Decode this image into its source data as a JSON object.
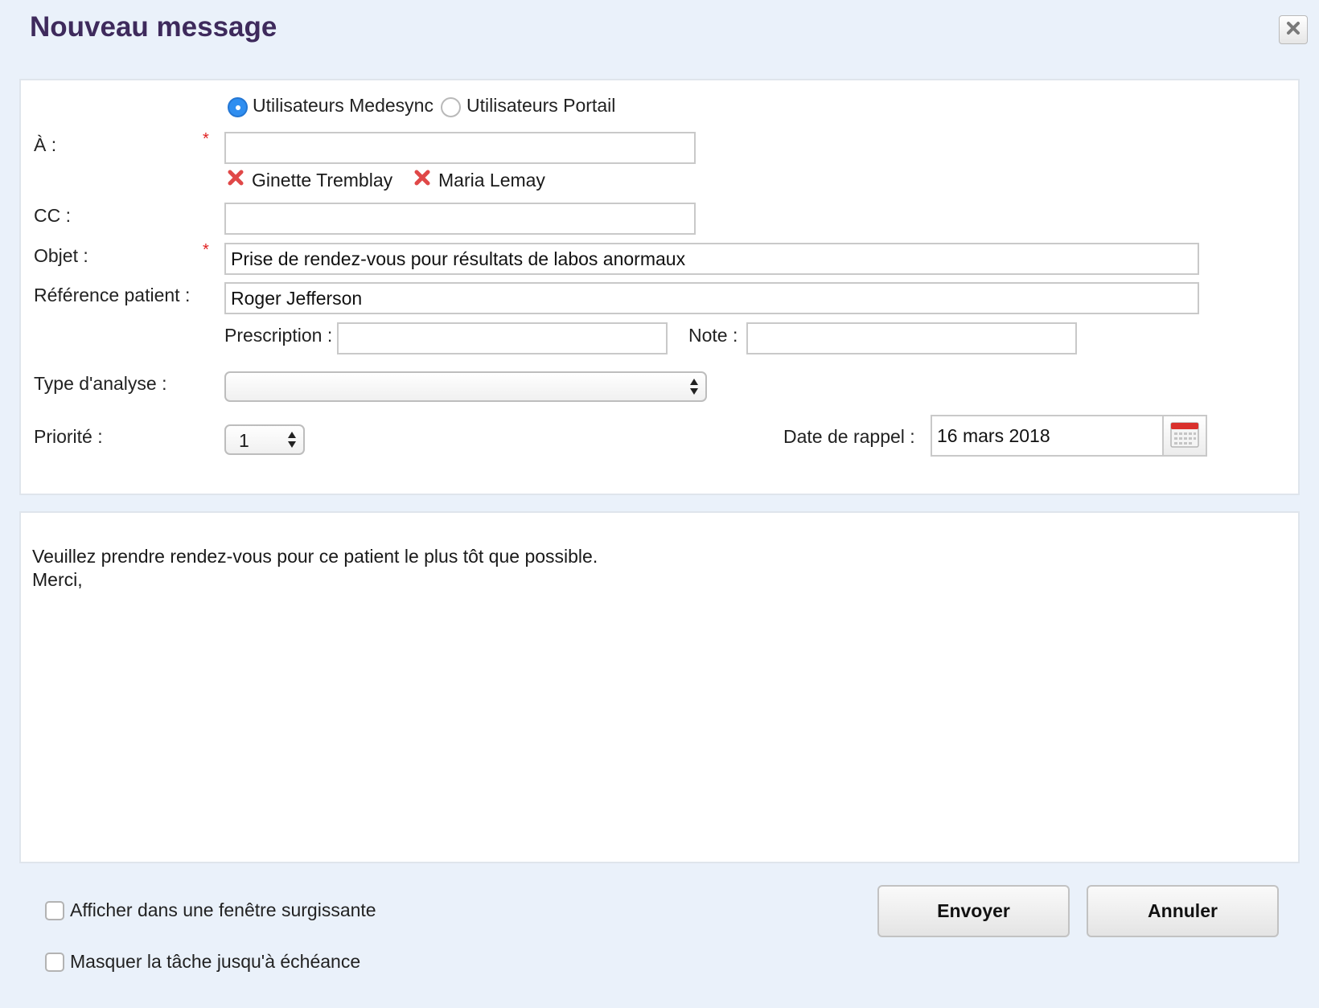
{
  "dialog": {
    "title": "Nouveau message",
    "close_icon": "close-icon"
  },
  "recipients_type": {
    "options": [
      {
        "label": "Utilisateurs Medesync",
        "checked": true
      },
      {
        "label": "Utilisateurs Portail",
        "checked": false
      }
    ]
  },
  "form": {
    "to": {
      "label": "À :",
      "required": "*",
      "value": ""
    },
    "recipients": [
      {
        "name": "Ginette Tremblay",
        "icon": "remove-icon"
      },
      {
        "name": "Maria Lemay",
        "icon": "remove-icon"
      }
    ],
    "cc": {
      "label": "CC :",
      "value": ""
    },
    "subject": {
      "label": "Objet :",
      "required": "*",
      "value": "Prise de rendez-vous pour résultats de labos anormaux"
    },
    "patient_ref": {
      "label": "Référence patient :",
      "value": "Roger Jefferson"
    },
    "prescription": {
      "label": "Prescription :",
      "value": ""
    },
    "note": {
      "label": "Note :",
      "value": ""
    },
    "analysis_type": {
      "label": "Type d'analyse :",
      "value": ""
    },
    "priority": {
      "label": "Priorité :",
      "value": "1"
    },
    "reminder_date": {
      "label": "Date de rappel :",
      "value": "16 mars 2018",
      "icon": "calendar-icon"
    }
  },
  "message": {
    "line1": "Veuillez prendre rendez-vous pour ce patient le plus tôt que possible.",
    "line2": "Merci,"
  },
  "options": {
    "popup": {
      "label": "Afficher dans une fenêtre surgissante",
      "checked": false
    },
    "hide_task": {
      "label": "Masquer la tâche jusqu'à échéance",
      "checked": false
    }
  },
  "buttons": {
    "send": "Envoyer",
    "cancel": "Annuler"
  },
  "colors": {
    "title": "#3e2a5c",
    "background": "#eaf1fa",
    "required": "#e02020",
    "radio_on": "#2f8ef0",
    "remove": "#e04848",
    "calendar_red": "#d9302c"
  }
}
